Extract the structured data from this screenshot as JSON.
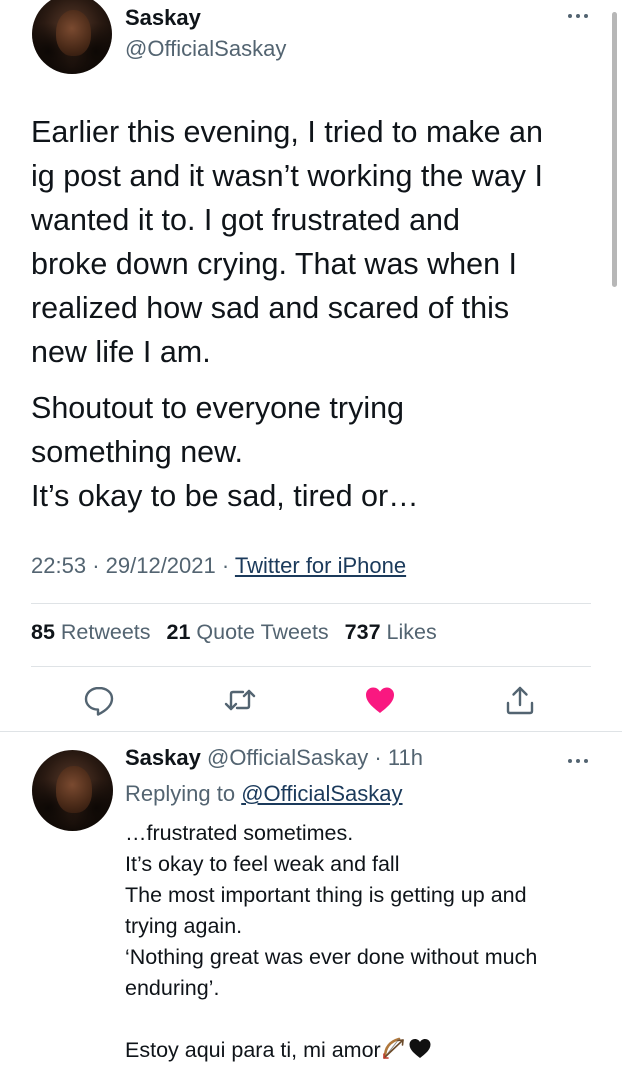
{
  "tweet": {
    "display_name": "Saskay",
    "handle": "@OfficialSaskay",
    "paragraphs": [
      "Earlier this evening, I tried to make an\nig post and it wasn’t working the way I\nwanted it to. I got frustrated and\nbroke down crying. That was when I\nrealized how sad and scared of this\nnew life I am.",
      "Shoutout to everyone trying\nsomething new.\nIt’s okay to be sad, tired or…"
    ],
    "time": "22:53",
    "date": "29/12/2021",
    "separator": "·",
    "source": "Twitter for iPhone",
    "stats": {
      "retweets_count": "85",
      "retweets_label": "Retweets",
      "quotes_count": "21",
      "quotes_label": "Quote Tweets",
      "likes_count": "737",
      "likes_label": "Likes"
    },
    "actions": {
      "reply_icon": "speech-bubble-icon",
      "retweet_icon": "retweet-arrows-icon",
      "like_icon": "heart-filled-icon",
      "share_icon": "share-upload-icon",
      "like_color": "#f91880"
    }
  },
  "reply": {
    "display_name": "Saskay",
    "handle_time": "@OfficialSaskay · 11h",
    "replying_to_label": "Replying to",
    "replying_to_mention": "@OfficialSaskay",
    "lines": [
      "…frustrated sometimes.",
      "It’s okay to feel weak and fall",
      "The most important thing is getting up and",
      "trying again.",
      "‘Nothing great was ever done without much",
      "enduring’."
    ],
    "closing": "Estoy aqui para ti, mi amor",
    "emojis": [
      "bow-and-arrow-icon",
      "black-heart-icon"
    ]
  },
  "colors": {
    "text": "#0f1419",
    "secondary": "#536471",
    "link": "#1b3a5b",
    "like": "#f91880"
  }
}
